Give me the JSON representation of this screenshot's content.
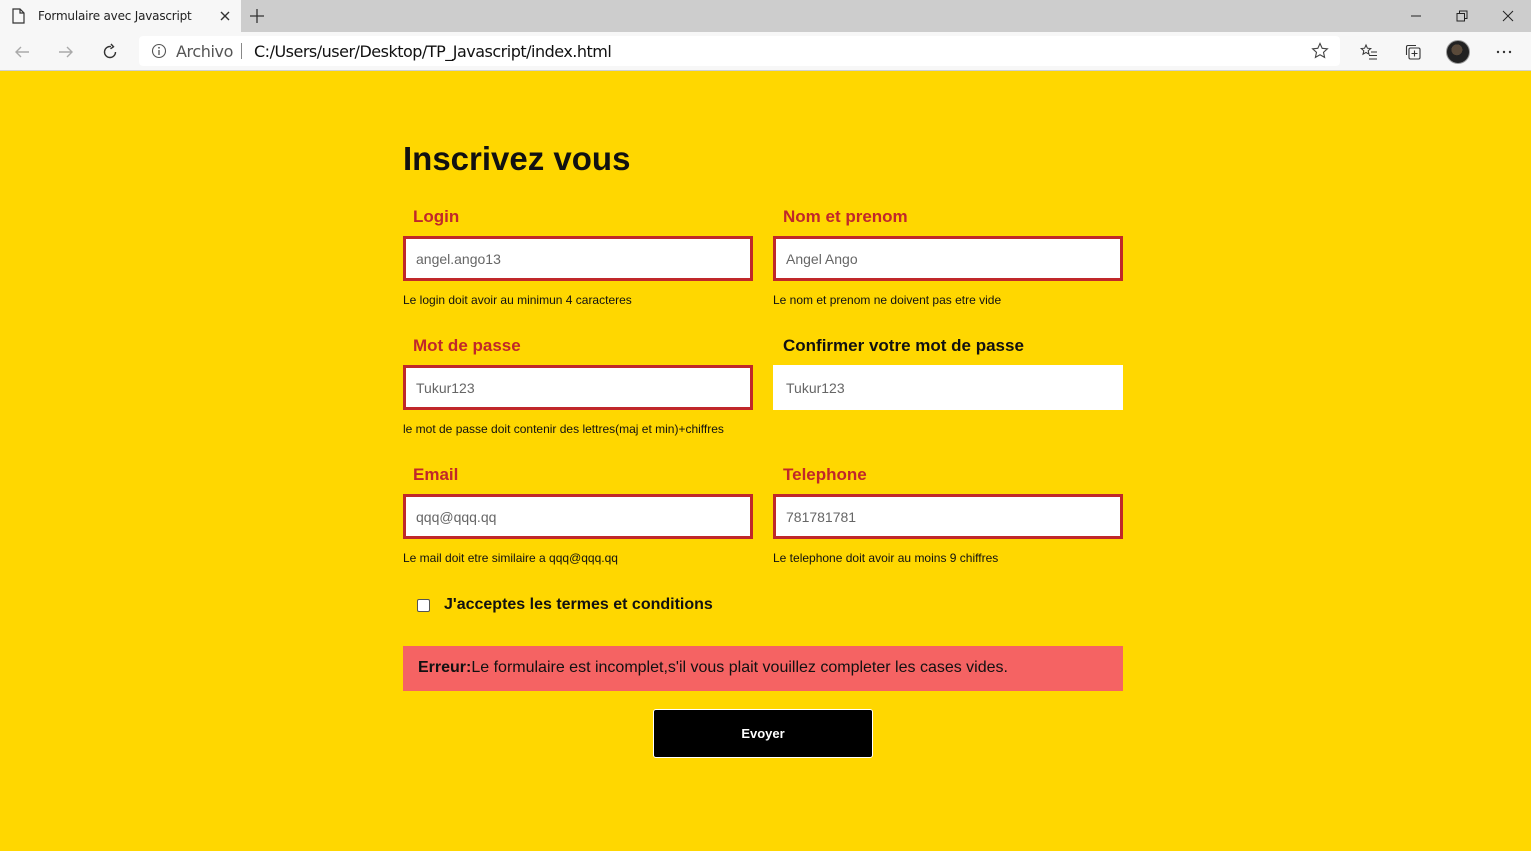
{
  "browser": {
    "tab_title": "Formulaire avec Javascript",
    "security_label": "Archivo",
    "url": "C:/Users/user/Desktop/TP_Javascript/index.html"
  },
  "form": {
    "title": "Inscrivez vous",
    "fields": [
      {
        "label": "Login",
        "value": "angel.ango13",
        "hint": "Le login doit avoir au minimun 4 caracteres",
        "state": "error"
      },
      {
        "label": "Nom et prenom",
        "value": "Angel Ango",
        "hint": "Le nom et prenom ne doivent pas etre vide",
        "state": "error"
      },
      {
        "label": "Mot de passe",
        "value": "Tukur123",
        "hint": "le mot de passe doit contenir des lettres(maj et min)+chiffres",
        "state": "error"
      },
      {
        "label": "Confirmer votre mot de passe",
        "value": "Tukur123",
        "hint": "",
        "state": "ok"
      },
      {
        "label": "Email",
        "value": "qqq@qqq.qq",
        "hint": "Le mail doit etre similaire a qqq@qqq.qq",
        "state": "error"
      },
      {
        "label": "Telephone",
        "value": "781781781",
        "hint": "Le telephone doit avoir au moins 9 chiffres",
        "state": "error"
      }
    ],
    "terms_label": "J'acceptes les termes et conditions",
    "terms_checked": false,
    "error_prefix": "Erreur:",
    "error_message": "Le formulaire est incomplet,s'il vous plait vouillez completer les cases vides.",
    "submit_label": "Evoyer"
  },
  "colors": {
    "page_background": "#ffd700",
    "error_red": "#c0282a",
    "error_box": "#f56363",
    "button": "#000000"
  }
}
